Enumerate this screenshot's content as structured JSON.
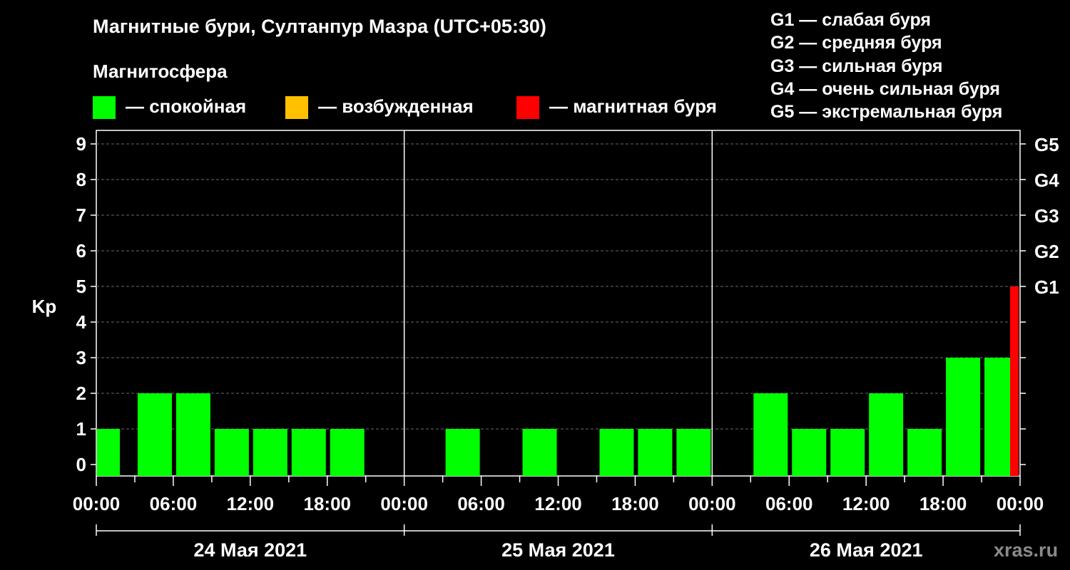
{
  "header": {
    "title": "Магнитные бури, Султанпур Мазра (UTC+05:30)",
    "subtitle": "Магнитосфера"
  },
  "legend": [
    {
      "color": "#00ff00",
      "label": "— спокойная"
    },
    {
      "color": "#ffc000",
      "label": "— возбужденная"
    },
    {
      "color": "#ff0000",
      "label": "— магнитная буря"
    }
  ],
  "g_legend": [
    "G1 — слабая буря",
    "G2 — средняя буря",
    "G3 — сильная буря",
    "G4 — очень сильная буря",
    "G5 — экстремальная буря"
  ],
  "watermark": "xras.ru",
  "chart_data": {
    "type": "bar",
    "ylabel": "Kp",
    "ylim": [
      0,
      9
    ],
    "y_ticks": [
      "0",
      "1",
      "2",
      "3",
      "4",
      "5",
      "6",
      "7",
      "8",
      "9"
    ],
    "g_ticks": [
      {
        "kp": 5,
        "label": "G1"
      },
      {
        "kp": 6,
        "label": "G2"
      },
      {
        "kp": 7,
        "label": "G3"
      },
      {
        "kp": 8,
        "label": "G4"
      },
      {
        "kp": 9,
        "label": "G5"
      }
    ],
    "x_tick_labels": [
      "00:00",
      "06:00",
      "12:00",
      "18:00",
      "00:00",
      "06:00",
      "12:00",
      "18:00",
      "00:00",
      "06:00",
      "12:00",
      "18:00",
      "00:00"
    ],
    "days": [
      "24 Мая 2021",
      "25 Мая 2021",
      "26 Мая 2021"
    ],
    "grid": true,
    "colors": {
      "quiet": "#00ff00",
      "active": "#ffc000",
      "storm": "#ff0000"
    },
    "bars": [
      {
        "day": 0,
        "hour": 0,
        "kp": 1,
        "status": "quiet"
      },
      {
        "day": 0,
        "hour": 3,
        "kp": 2,
        "status": "quiet"
      },
      {
        "day": 0,
        "hour": 6,
        "kp": 2,
        "status": "quiet"
      },
      {
        "day": 0,
        "hour": 9,
        "kp": 1,
        "status": "quiet"
      },
      {
        "day": 0,
        "hour": 12,
        "kp": 1,
        "status": "quiet"
      },
      {
        "day": 0,
        "hour": 15,
        "kp": 1,
        "status": "quiet"
      },
      {
        "day": 0,
        "hour": 18,
        "kp": 1,
        "status": "quiet"
      },
      {
        "day": 0,
        "hour": 21,
        "kp": 0,
        "status": "quiet"
      },
      {
        "day": 1,
        "hour": 0,
        "kp": 0,
        "status": "quiet"
      },
      {
        "day": 1,
        "hour": 3,
        "kp": 1,
        "status": "quiet"
      },
      {
        "day": 1,
        "hour": 6,
        "kp": 0,
        "status": "quiet"
      },
      {
        "day": 1,
        "hour": 9,
        "kp": 1,
        "status": "quiet"
      },
      {
        "day": 1,
        "hour": 12,
        "kp": 0,
        "status": "quiet"
      },
      {
        "day": 1,
        "hour": 15,
        "kp": 1,
        "status": "quiet"
      },
      {
        "day": 1,
        "hour": 18,
        "kp": 1,
        "status": "quiet"
      },
      {
        "day": 1,
        "hour": 21,
        "kp": 1,
        "status": "quiet"
      },
      {
        "day": 2,
        "hour": 0,
        "kp": 0,
        "status": "quiet"
      },
      {
        "day": 2,
        "hour": 3,
        "kp": 2,
        "status": "quiet"
      },
      {
        "day": 2,
        "hour": 6,
        "kp": 1,
        "status": "quiet"
      },
      {
        "day": 2,
        "hour": 9,
        "kp": 1,
        "status": "quiet"
      },
      {
        "day": 2,
        "hour": 12,
        "kp": 2,
        "status": "quiet"
      },
      {
        "day": 2,
        "hour": 15,
        "kp": 1,
        "status": "quiet"
      },
      {
        "day": 2,
        "hour": 18,
        "kp": 3,
        "status": "quiet"
      },
      {
        "day": 2,
        "hour": 21,
        "kp": 3,
        "status": "quiet"
      },
      {
        "day": 2,
        "hour": 24,
        "kp": 5,
        "status": "storm"
      }
    ]
  }
}
